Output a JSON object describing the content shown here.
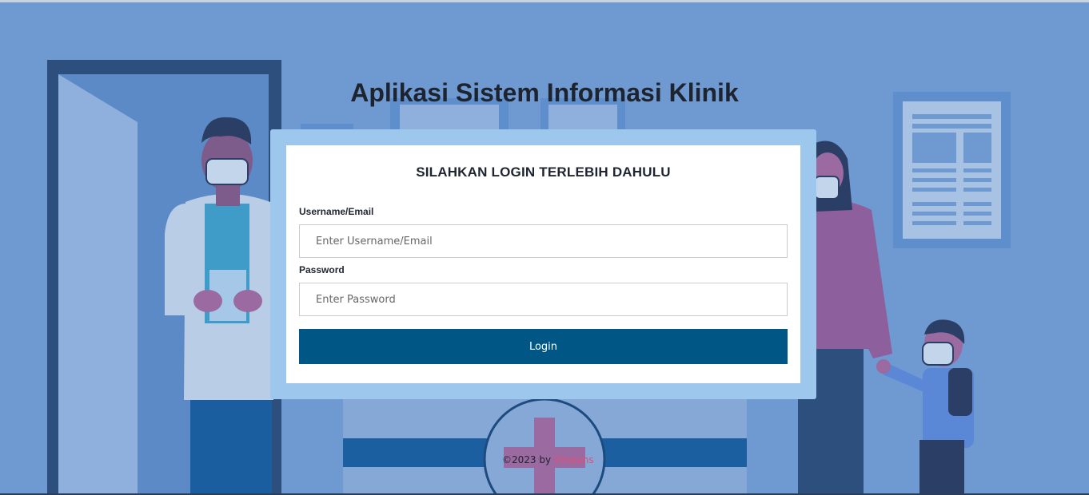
{
  "page": {
    "title": "Aplikasi Sistem Informasi Klinik"
  },
  "login": {
    "heading": "SILAHKAN LOGIN TERLEBIH DAHULU",
    "username_label": "Username/Email",
    "username_placeholder": "Enter Username/Email",
    "username_value": "",
    "password_label": "Password",
    "password_placeholder": "Enter Password",
    "password_value": "",
    "button_label": "Login"
  },
  "footer": {
    "copyright": "©2023 by ",
    "author": "Omeans"
  },
  "colors": {
    "background": "#6f99d1",
    "card_border": "#9ec7ee",
    "button": "#005684",
    "author_link": "#e04f7a"
  }
}
